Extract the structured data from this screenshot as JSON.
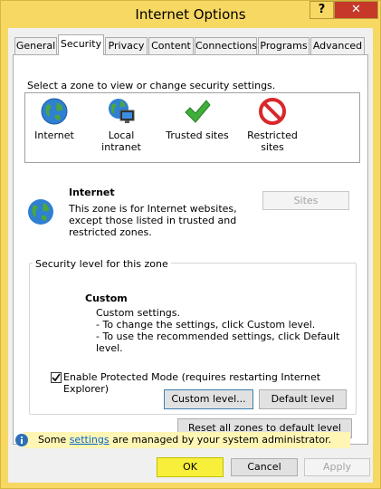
{
  "window": {
    "title": "Internet Options",
    "help_label": "?",
    "close_label": "✕"
  },
  "tabs": [
    {
      "label": "General"
    },
    {
      "label": "Security",
      "active": true
    },
    {
      "label": "Privacy"
    },
    {
      "label": "Content"
    },
    {
      "label": "Connections"
    },
    {
      "label": "Programs"
    },
    {
      "label": "Advanced"
    }
  ],
  "security": {
    "zone_prompt": "Select a zone to view or change security settings.",
    "zones": [
      {
        "label": "Internet",
        "icon": "globe-icon",
        "selected": true
      },
      {
        "label": "Local intranet",
        "icon": "intranet-icon"
      },
      {
        "label": "Trusted sites",
        "icon": "checkmark-icon"
      },
      {
        "label_line1": "Restricted",
        "label_line2": "sites",
        "icon": "restricted-icon"
      }
    ],
    "selected_zone": {
      "title": "Internet",
      "desc_line1": "This zone is for Internet websites,",
      "desc_line2": "except those listed in trusted and",
      "desc_line3": "restricted zones.",
      "sites_label": "Sites"
    },
    "level_group_label": "Security level for this zone",
    "custom": {
      "title": "Custom",
      "line1": "Custom settings.",
      "line2": "- To change the settings, click Custom level.",
      "line3": "- To use the recommended settings, click Default level."
    },
    "protected_mode": {
      "label": "Enable Protected Mode (requires restarting Internet Explorer)",
      "checked": true
    },
    "custom_level_label": "Custom level...",
    "default_level_label": "Default level",
    "reset_all_label": "Reset all zones to default level",
    "info": {
      "before": "Some",
      "link": "settings",
      "after": "are managed by your system administrator."
    }
  },
  "footer": {
    "ok_label": "OK",
    "cancel_label": "Cancel",
    "apply_label": "Apply"
  },
  "colors": {
    "title_bar": "#f7d862",
    "close_button": "#c63929",
    "ok_highlight": "#f7ef3a",
    "info_bar": "#fff5b4",
    "link": "#0066cc"
  }
}
